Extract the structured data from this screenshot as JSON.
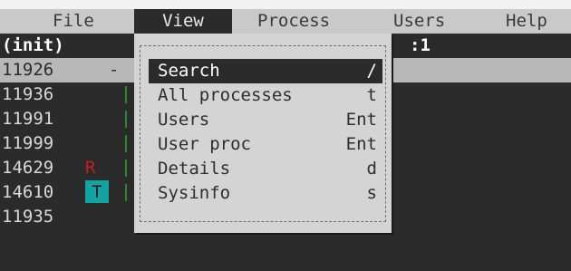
{
  "menubar": {
    "items": [
      {
        "label": "File",
        "active": false
      },
      {
        "label": "View",
        "active": true
      },
      {
        "label": "Process",
        "active": false
      },
      {
        "label": "Users",
        "active": false
      },
      {
        "label": "Help",
        "active": false
      }
    ]
  },
  "header": {
    "title": "(init)",
    "right_fragment": ":1"
  },
  "processes": [
    {
      "pid": "11926",
      "flag": "-",
      "state": "",
      "selected": true
    },
    {
      "pid": "11936",
      "flag": "",
      "state": "",
      "selected": false
    },
    {
      "pid": "11991",
      "flag": "",
      "state": "",
      "selected": false
    },
    {
      "pid": "11999",
      "flag": "",
      "state": "",
      "selected": false
    },
    {
      "pid": "14629",
      "flag": "",
      "state": "R",
      "selected": false
    },
    {
      "pid": "14610",
      "flag": "",
      "state": "T",
      "selected": false
    },
    {
      "pid": "11935",
      "flag": "",
      "state": "",
      "selected": false
    }
  ],
  "view_menu": {
    "items": [
      {
        "label": "Search",
        "key": "/",
        "selected": true
      },
      {
        "label": "All processes",
        "key": "t",
        "selected": false
      },
      {
        "label": "Users",
        "key": "Ent",
        "selected": false
      },
      {
        "label": "User proc",
        "key": "Ent",
        "selected": false
      },
      {
        "label": "Details",
        "key": "d",
        "selected": false
      },
      {
        "label": "Sysinfo",
        "key": "s",
        "selected": false
      }
    ]
  },
  "colors": {
    "background": "#2b2b2b",
    "menubar": "#c9c9c9",
    "popup": "#d4d4d4",
    "state_running": "#c81e1e",
    "state_stopped": "#14a3a3",
    "tree_line": "#2a8a2a"
  }
}
